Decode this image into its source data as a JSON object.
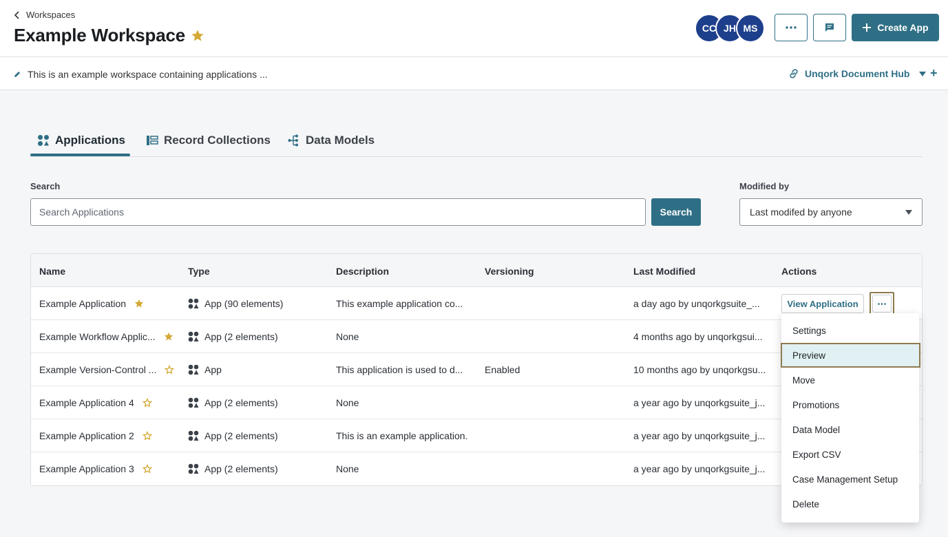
{
  "header": {
    "back_label": "Workspaces",
    "title": "Example Workspace",
    "avatars": [
      "CC",
      "JH",
      "MS"
    ],
    "create_label": "Create App"
  },
  "description_bar": {
    "text": "This is an example workspace containing applications ...",
    "hub_label": "Unqork Document Hub"
  },
  "tabs": [
    {
      "label": "Applications",
      "active": true
    },
    {
      "label": "Record Collections",
      "active": false
    },
    {
      "label": "Data Models",
      "active": false
    }
  ],
  "search": {
    "label": "Search",
    "placeholder": "Search Applications",
    "button_label": "Search"
  },
  "filter": {
    "label": "Modified by",
    "value": "Last modifed by anyone"
  },
  "table": {
    "headers": [
      "Name",
      "Type",
      "Description",
      "Versioning",
      "Last Modified",
      "Actions"
    ],
    "rows": [
      {
        "name": "Example Application",
        "starred": true,
        "type": "App (90 elements)",
        "description": "This example application co...",
        "versioning": "",
        "modified": "a day ago by unqorkgsuite_..."
      },
      {
        "name": "Example Workflow Applic...",
        "starred": true,
        "type": "App (2 elements)",
        "description": "None",
        "versioning": "",
        "modified": "4 months ago by unqorkgsui..."
      },
      {
        "name": "Example Version-Control ...",
        "starred": false,
        "type": "App",
        "description": "This application is used to d...",
        "versioning": "Enabled",
        "modified": "10 months ago by unqorkgsu..."
      },
      {
        "name": "Example Application 4",
        "starred": false,
        "type": "App (2 elements)",
        "description": "None",
        "versioning": "",
        "modified": "a year ago by unqorkgsuite_j..."
      },
      {
        "name": "Example Application 2",
        "starred": false,
        "type": "App (2 elements)",
        "description": "This is an example application.",
        "versioning": "",
        "modified": "a year ago by unqorkgsuite_j..."
      },
      {
        "name": "Example Application 3",
        "starred": false,
        "type": "App (2 elements)",
        "description": "None",
        "versioning": "",
        "modified": "a year ago by unqorkgsuite_j..."
      }
    ],
    "view_button_label": "View Application"
  },
  "menu": {
    "items": [
      "Settings",
      "Preview",
      "Move",
      "Promotions",
      "Data Model",
      "Export CSV",
      "Case Management Setup",
      "Delete"
    ],
    "active_item": "Preview"
  },
  "colors": {
    "accent": "#2f6f86",
    "star": "#d4a936",
    "avatar": "#1d3f8c"
  }
}
